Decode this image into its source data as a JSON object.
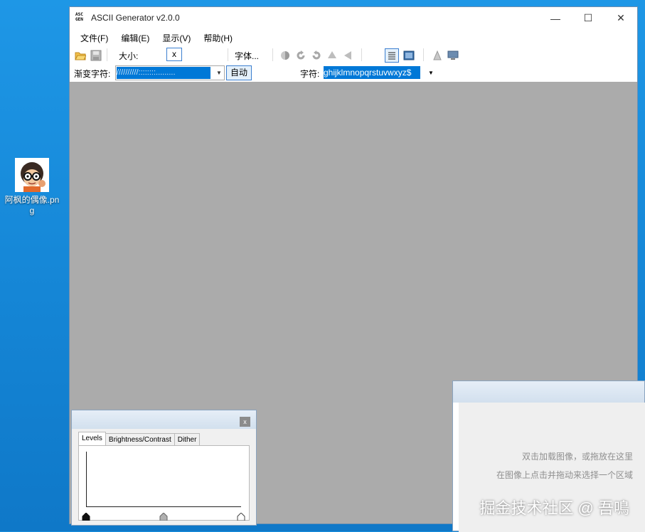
{
  "desktop": {
    "icon_label": "阿枫的偶像.png"
  },
  "window": {
    "title": "ASCII Generator v2.0.0",
    "logo_line1": "ASC",
    "logo_line2": "GEN",
    "controls": {
      "minimize": "—",
      "maximize": "☐",
      "close": "✕"
    }
  },
  "menubar": {
    "items": [
      "文件(F)",
      "编辑(E)",
      "显示(V)",
      "帮助(H)"
    ]
  },
  "toolbar": {
    "size_label": "大小:",
    "size_width": "",
    "size_separator": "x",
    "size_height": "",
    "font_button": "字体..."
  },
  "toolbar2": {
    "ramp_label": "渐变字符:",
    "ramp_value": "//////////::::::::.........",
    "auto_button": "自动",
    "chars_label": "字符:",
    "chars_value": "ghijklmnopqrstuvwxyz$"
  },
  "levels_panel": {
    "close": "x",
    "tabs": [
      "Levels",
      "Brightness/Contrast",
      "Dither"
    ],
    "active_tab": "Levels"
  },
  "preview_panel": {
    "hint_line1": "双击加载图像，或拖放在这里",
    "hint_line2": "在图像上点击并拖动来选择一个区域"
  },
  "watermark": "掘金技术社区 @ 吾鳴",
  "colors": {
    "desktop": "#1a8fdd",
    "workspace": "#ababab",
    "selection": "#0078d7",
    "accent_border": "#3c7fd0"
  }
}
